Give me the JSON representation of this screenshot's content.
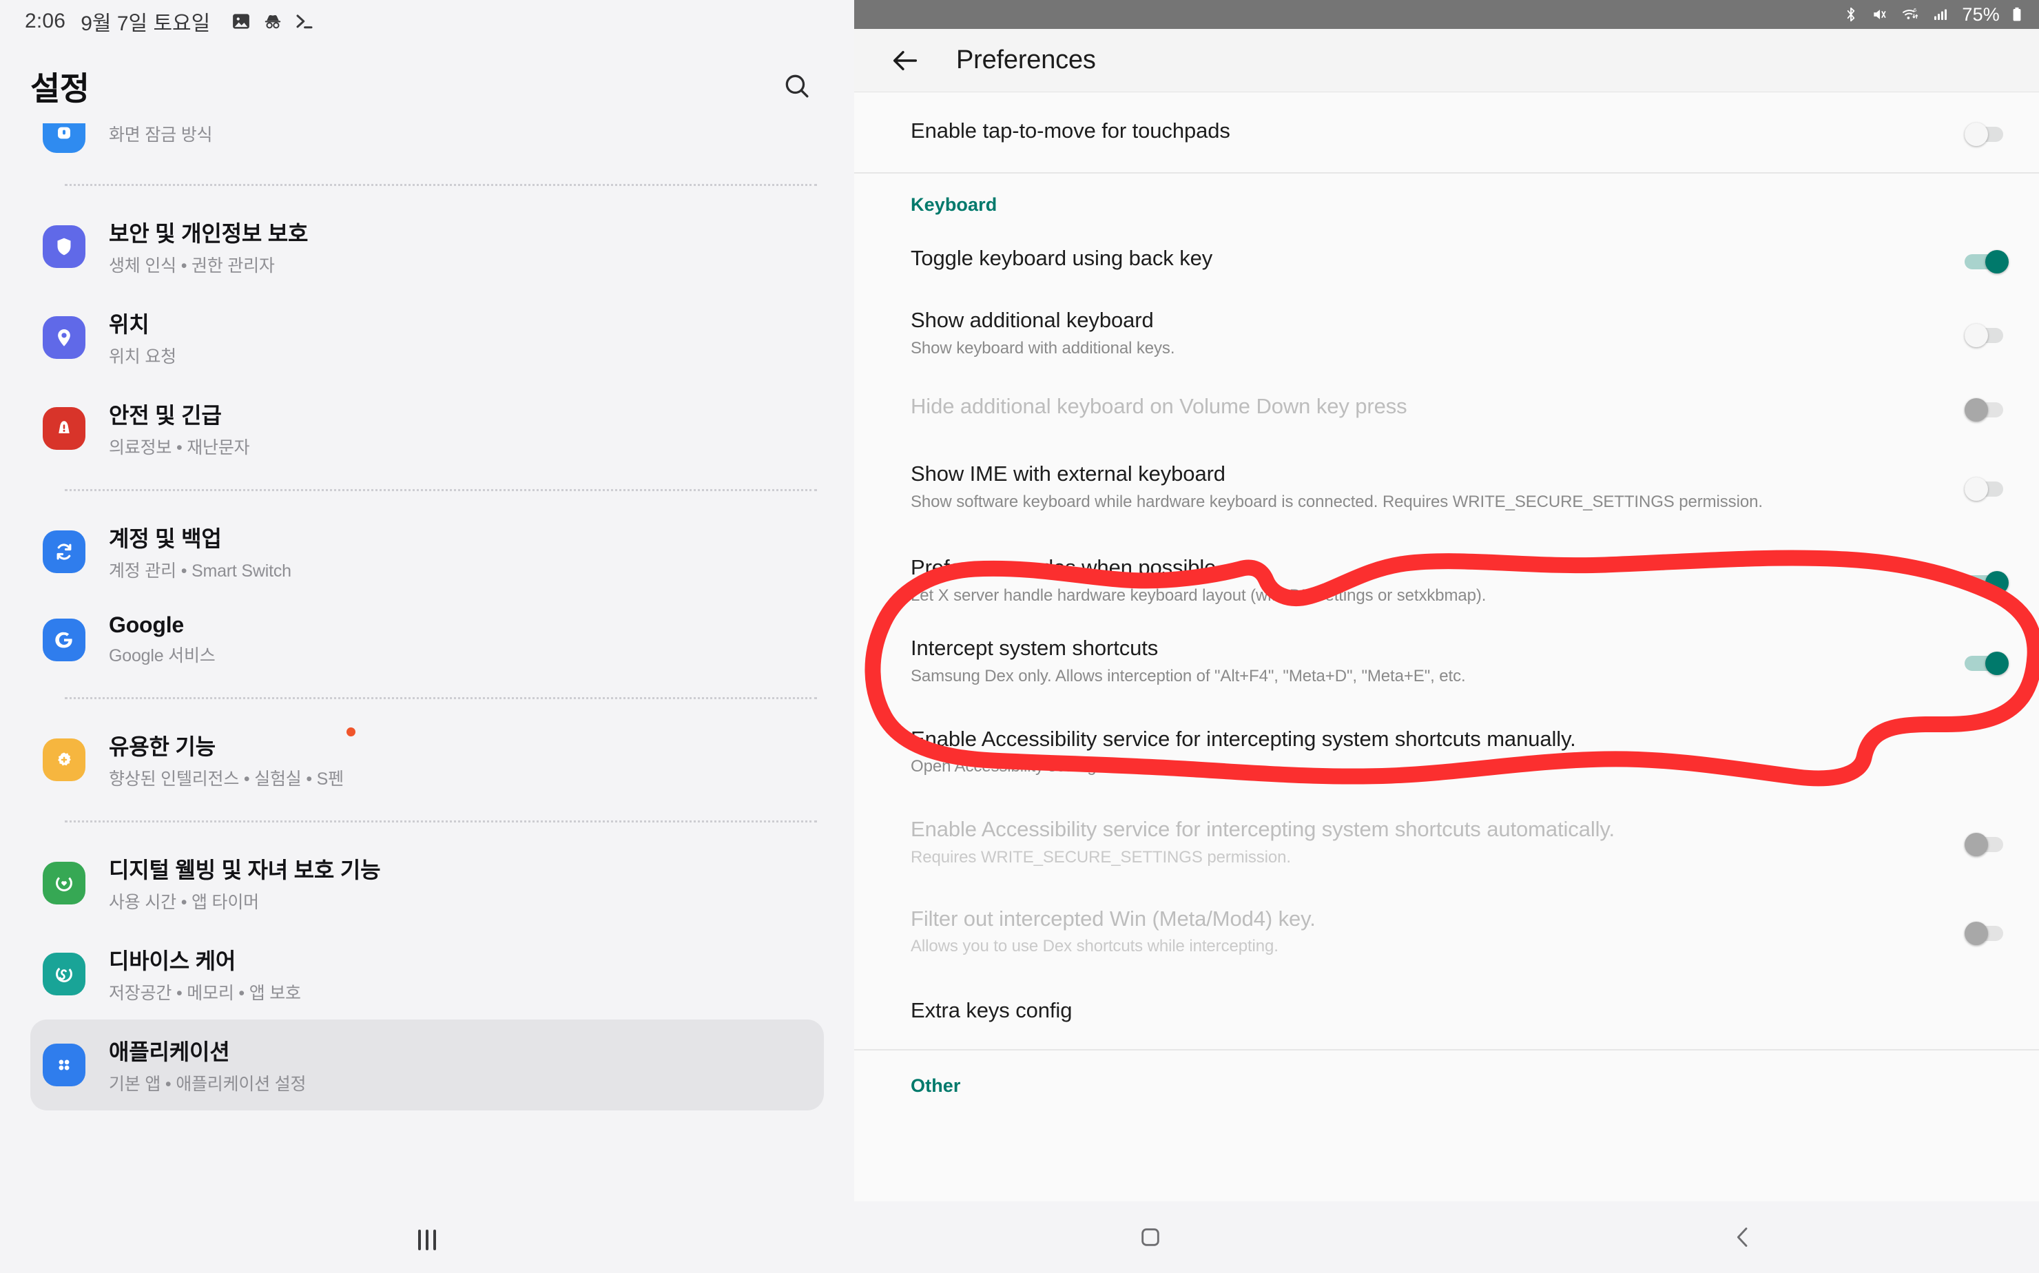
{
  "left_panel": {
    "status_bar": {
      "time": "2:06",
      "date": "9월 7일 토요일",
      "icons": [
        "image-icon",
        "incognito-icon",
        "terminal-icon"
      ]
    },
    "title": "설정",
    "search_icon": "search-icon",
    "items": [
      {
        "id": "lock-screen",
        "title": "",
        "subtitle": "화면 잠금 방식",
        "icon": "lock-icon",
        "icon_color": "#2f8bf0",
        "clipped": true,
        "badge": false,
        "selected": false
      },
      {
        "id": "security-privacy",
        "title": "보안 및 개인정보 보호",
        "subtitle": "생체 인식 • 권한 관리자",
        "icon": "shield-icon",
        "icon_color": "#6069e8",
        "clipped": false,
        "badge": false,
        "selected": false
      },
      {
        "id": "location",
        "title": "위치",
        "subtitle": "위치 요청",
        "icon": "location-pin-icon",
        "icon_color": "#6069e8",
        "clipped": false,
        "badge": false,
        "selected": false
      },
      {
        "id": "safety-emergency",
        "title": "안전 및 긴급",
        "subtitle": "의료정보 • 재난문자",
        "icon": "emergency-alert-icon",
        "icon_color": "#d8342a",
        "clipped": false,
        "badge": false,
        "selected": false
      },
      {
        "id": "accounts-backup",
        "title": "계정 및 백업",
        "subtitle": "계정 관리 • Smart Switch",
        "icon": "sync-icon",
        "icon_color": "#2f7ded",
        "clipped": false,
        "badge": false,
        "selected": false
      },
      {
        "id": "google",
        "title": "Google",
        "subtitle": "Google 서비스",
        "icon": "google-g-icon",
        "icon_color": "#2f7ded",
        "clipped": false,
        "badge": false,
        "selected": false
      },
      {
        "id": "advanced-features",
        "title": "유용한 기능",
        "subtitle": "향상된 인텔리전스 • 실험실 • S펜",
        "icon": "gear-flower-icon",
        "icon_color": "#f6b63f",
        "clipped": false,
        "badge": true,
        "badge_color": "#f0552b",
        "selected": false
      },
      {
        "id": "digital-wellbeing",
        "title": "디지털 웰빙 및 자녀 보호 기능",
        "subtitle": "사용 시간 • 앱 타이머",
        "icon": "wellbeing-heart-icon",
        "icon_color": "#36a854",
        "clipped": false,
        "badge": false,
        "selected": false
      },
      {
        "id": "device-care",
        "title": "디바이스 케어",
        "subtitle": "저장공간 • 메모리 • 앱 보호",
        "icon": "device-care-icon",
        "icon_color": "#19a497",
        "clipped": false,
        "badge": false,
        "selected": false
      },
      {
        "id": "applications",
        "title": "애플리케이션",
        "subtitle": "기본 앱 • 애플리케이션 설정",
        "icon": "apps-grid-icon",
        "icon_color": "#2f7ded",
        "clipped": false,
        "badge": false,
        "selected": true
      }
    ],
    "dividers_after": [
      "lock-screen",
      "safety-emergency",
      "google",
      "advanced-features"
    ],
    "nav_bar": {
      "recents_icon": "three-bars-icon"
    }
  },
  "right_panel": {
    "status_bar": {
      "battery_text": "75%",
      "icons": [
        "bluetooth-icon",
        "mute-vibrate-icon",
        "wifi-6-icon",
        "cellular-signal-icon",
        "battery-icon"
      ],
      "background": "#757575"
    },
    "app_bar": {
      "back_icon": "back-arrow-icon",
      "title": "Preferences"
    },
    "accent_color": "#00796b",
    "annotation": {
      "type": "hand-drawn-ellipse",
      "color": "#fb2f2f",
      "target": "Prefer scancodes when possible"
    },
    "rows": [
      {
        "id": "tap-to-move",
        "kind": "switch",
        "title": "Enable tap-to-move for touchpads",
        "subtitle": "",
        "state": "off",
        "disabled": false,
        "separator_after": true
      },
      {
        "id": "keyboard-section",
        "kind": "section",
        "title": "Keyboard"
      },
      {
        "id": "toggle-keyboard-back-key",
        "kind": "switch",
        "title": "Toggle keyboard using back key",
        "subtitle": "",
        "state": "on",
        "disabled": false,
        "separator_after": false
      },
      {
        "id": "show-additional-keyboard",
        "kind": "switch",
        "title": "Show additional keyboard",
        "subtitle": "Show keyboard with additional keys.",
        "state": "off",
        "disabled": false,
        "separator_after": false
      },
      {
        "id": "hide-additional-keyboard",
        "kind": "switch",
        "title": "Hide additional keyboard on Volume Down key press",
        "subtitle": "",
        "state": "dis",
        "disabled": true,
        "separator_after": false
      },
      {
        "id": "show-ime-external-keyboard",
        "kind": "switch",
        "title": "Show IME with external keyboard",
        "subtitle": "Show software keyboard while hardware keyboard is connected. Requires WRITE_SECURE_SETTINGS permission.",
        "state": "off",
        "disabled": false,
        "separator_after": false
      },
      {
        "id": "prefer-scancodes",
        "kind": "switch",
        "title": "Prefer scancodes when possible",
        "subtitle": "Let X server handle hardware keyboard layout (with DE settings or setxkbmap).",
        "state": "on",
        "disabled": false,
        "highlighted": true,
        "separator_after": false
      },
      {
        "id": "intercept-system-shortcuts",
        "kind": "switch",
        "title": "Intercept system shortcuts",
        "subtitle": "Samsung Dex only. Allows interception of \"Alt+F4\", \"Meta+D\", \"Meta+E\", etc.",
        "state": "on",
        "disabled": false,
        "separator_after": false
      },
      {
        "id": "accessibility-manual",
        "kind": "plain",
        "title": "Enable Accessibility service for intercepting system shortcuts manually.",
        "subtitle": "Open Accessibility settings.",
        "state": "none",
        "disabled": false,
        "separator_after": false
      },
      {
        "id": "accessibility-automatic",
        "kind": "switch",
        "title": "Enable Accessibility service for intercepting system shortcuts automatically.",
        "subtitle": "Requires WRITE_SECURE_SETTINGS permission.",
        "state": "dis",
        "disabled": true,
        "separator_after": false
      },
      {
        "id": "filter-win-key",
        "kind": "switch",
        "title": "Filter out intercepted Win (Meta/Mod4) key.",
        "subtitle": "Allows you to use Dex shortcuts while intercepting.",
        "state": "dis",
        "disabled": true,
        "separator_after": false
      },
      {
        "id": "extra-keys-config",
        "kind": "plain",
        "title": "Extra keys config",
        "subtitle": "",
        "state": "none",
        "disabled": false,
        "separator_after": true
      },
      {
        "id": "other-section",
        "kind": "section",
        "title": "Other"
      }
    ],
    "nav_bar": {
      "home_icon": "home-circle-icon",
      "back_icon": "back-chevron-icon"
    }
  }
}
